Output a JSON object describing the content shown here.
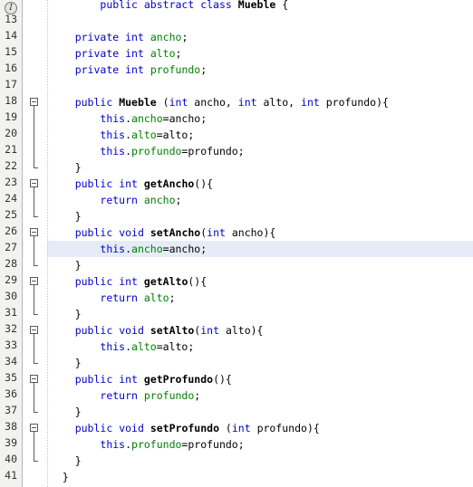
{
  "editor": {
    "language": "java",
    "class_name": "Mueble",
    "caret_line": 27,
    "first_line_number": 13,
    "last_line_number": 41,
    "colors": {
      "background": "#ffffff",
      "gutter_background": "#f2f2f0",
      "gutter_border": "#b8b8b0",
      "line_number": "#333333",
      "caret_line_highlight": "#e6ecf7",
      "keyword": "#0000cd",
      "field": "#008000",
      "declaration": "#000000",
      "plain": "#000000",
      "fold_marker": "#5a5a5a",
      "indent_guide": "#c9c9c9"
    },
    "annotation_icon": {
      "name": "info-annotation-icon",
      "glyph": "I"
    },
    "fold_markers": [
      18,
      23,
      26,
      29,
      32,
      35,
      38
    ],
    "lines": [
      {
        "number": "",
        "partial": true,
        "tokens": [
          {
            "t": "        ",
            "c": "pl"
          },
          {
            "t": "public",
            "c": "kw"
          },
          {
            "t": " ",
            "c": "pl"
          },
          {
            "t": "abstract",
            "c": "kw"
          },
          {
            "t": " ",
            "c": "pl"
          },
          {
            "t": "class",
            "c": "kw"
          },
          {
            "t": " ",
            "c": "pl"
          },
          {
            "t": "Mueble",
            "c": "nm"
          },
          {
            "t": " {",
            "c": "pl"
          }
        ]
      },
      {
        "number": "13",
        "tokens": []
      },
      {
        "number": "14",
        "tokens": [
          {
            "t": "    ",
            "c": "pl"
          },
          {
            "t": "private",
            "c": "kw"
          },
          {
            "t": " ",
            "c": "pl"
          },
          {
            "t": "int",
            "c": "kw"
          },
          {
            "t": " ",
            "c": "pl"
          },
          {
            "t": "ancho",
            "c": "fld"
          },
          {
            "t": ";",
            "c": "pl"
          }
        ]
      },
      {
        "number": "15",
        "tokens": [
          {
            "t": "    ",
            "c": "pl"
          },
          {
            "t": "private",
            "c": "kw"
          },
          {
            "t": " ",
            "c": "pl"
          },
          {
            "t": "int",
            "c": "kw"
          },
          {
            "t": " ",
            "c": "pl"
          },
          {
            "t": "alto",
            "c": "fld"
          },
          {
            "t": ";",
            "c": "pl"
          }
        ]
      },
      {
        "number": "16",
        "tokens": [
          {
            "t": "    ",
            "c": "pl"
          },
          {
            "t": "private",
            "c": "kw"
          },
          {
            "t": " ",
            "c": "pl"
          },
          {
            "t": "int",
            "c": "kw"
          },
          {
            "t": " ",
            "c": "pl"
          },
          {
            "t": "profundo",
            "c": "fld"
          },
          {
            "t": ";",
            "c": "pl"
          }
        ]
      },
      {
        "number": "17",
        "tokens": []
      },
      {
        "number": "18",
        "tokens": [
          {
            "t": "    ",
            "c": "pl"
          },
          {
            "t": "public",
            "c": "kw"
          },
          {
            "t": " ",
            "c": "pl"
          },
          {
            "t": "Mueble",
            "c": "nm"
          },
          {
            "t": " (",
            "c": "pl"
          },
          {
            "t": "int",
            "c": "kw"
          },
          {
            "t": " ancho, ",
            "c": "pl"
          },
          {
            "t": "int",
            "c": "kw"
          },
          {
            "t": " alto, ",
            "c": "pl"
          },
          {
            "t": "int",
            "c": "kw"
          },
          {
            "t": " profundo){",
            "c": "pl"
          }
        ]
      },
      {
        "number": "19",
        "tokens": [
          {
            "t": "        ",
            "c": "pl"
          },
          {
            "t": "this",
            "c": "kw"
          },
          {
            "t": ".",
            "c": "pl"
          },
          {
            "t": "ancho",
            "c": "fld"
          },
          {
            "t": "=ancho;",
            "c": "pl"
          }
        ]
      },
      {
        "number": "20",
        "tokens": [
          {
            "t": "        ",
            "c": "pl"
          },
          {
            "t": "this",
            "c": "kw"
          },
          {
            "t": ".",
            "c": "pl"
          },
          {
            "t": "alto",
            "c": "fld"
          },
          {
            "t": "=alto;",
            "c": "pl"
          }
        ]
      },
      {
        "number": "21",
        "tokens": [
          {
            "t": "        ",
            "c": "pl"
          },
          {
            "t": "this",
            "c": "kw"
          },
          {
            "t": ".",
            "c": "pl"
          },
          {
            "t": "profundo",
            "c": "fld"
          },
          {
            "t": "=profundo;",
            "c": "pl"
          }
        ]
      },
      {
        "number": "22",
        "tokens": [
          {
            "t": "    }",
            "c": "pl"
          }
        ]
      },
      {
        "number": "23",
        "tokens": [
          {
            "t": "    ",
            "c": "pl"
          },
          {
            "t": "public",
            "c": "kw"
          },
          {
            "t": " ",
            "c": "pl"
          },
          {
            "t": "int",
            "c": "kw"
          },
          {
            "t": " ",
            "c": "pl"
          },
          {
            "t": "getAncho",
            "c": "nm"
          },
          {
            "t": "(){",
            "c": "pl"
          }
        ]
      },
      {
        "number": "24",
        "tokens": [
          {
            "t": "        ",
            "c": "pl"
          },
          {
            "t": "return",
            "c": "kw"
          },
          {
            "t": " ",
            "c": "pl"
          },
          {
            "t": "ancho",
            "c": "fld"
          },
          {
            "t": ";",
            "c": "pl"
          }
        ]
      },
      {
        "number": "25",
        "tokens": [
          {
            "t": "    }",
            "c": "pl"
          }
        ]
      },
      {
        "number": "26",
        "tokens": [
          {
            "t": "    ",
            "c": "pl"
          },
          {
            "t": "public",
            "c": "kw"
          },
          {
            "t": " ",
            "c": "pl"
          },
          {
            "t": "void",
            "c": "kw"
          },
          {
            "t": " ",
            "c": "pl"
          },
          {
            "t": "setAncho",
            "c": "nm"
          },
          {
            "t": "(",
            "c": "pl"
          },
          {
            "t": "int",
            "c": "kw"
          },
          {
            "t": " ancho){",
            "c": "pl"
          }
        ]
      },
      {
        "number": "27",
        "highlight": true,
        "tokens": [
          {
            "t": "        ",
            "c": "pl"
          },
          {
            "t": "this",
            "c": "kw"
          },
          {
            "t": ".",
            "c": "pl"
          },
          {
            "t": "ancho",
            "c": "fld"
          },
          {
            "t": "=ancho;",
            "c": "pl"
          }
        ]
      },
      {
        "number": "28",
        "tokens": [
          {
            "t": "    }",
            "c": "pl"
          }
        ]
      },
      {
        "number": "29",
        "tokens": [
          {
            "t": "    ",
            "c": "pl"
          },
          {
            "t": "public",
            "c": "kw"
          },
          {
            "t": " ",
            "c": "pl"
          },
          {
            "t": "int",
            "c": "kw"
          },
          {
            "t": " ",
            "c": "pl"
          },
          {
            "t": "getAlto",
            "c": "nm"
          },
          {
            "t": "(){",
            "c": "pl"
          }
        ]
      },
      {
        "number": "30",
        "tokens": [
          {
            "t": "        ",
            "c": "pl"
          },
          {
            "t": "return",
            "c": "kw"
          },
          {
            "t": " ",
            "c": "pl"
          },
          {
            "t": "alto",
            "c": "fld"
          },
          {
            "t": ";",
            "c": "pl"
          }
        ]
      },
      {
        "number": "31",
        "tokens": [
          {
            "t": "    }",
            "c": "pl"
          }
        ]
      },
      {
        "number": "32",
        "tokens": [
          {
            "t": "    ",
            "c": "pl"
          },
          {
            "t": "public",
            "c": "kw"
          },
          {
            "t": " ",
            "c": "pl"
          },
          {
            "t": "void",
            "c": "kw"
          },
          {
            "t": " ",
            "c": "pl"
          },
          {
            "t": "setAlto",
            "c": "nm"
          },
          {
            "t": "(",
            "c": "pl"
          },
          {
            "t": "int",
            "c": "kw"
          },
          {
            "t": " alto){",
            "c": "pl"
          }
        ]
      },
      {
        "number": "33",
        "tokens": [
          {
            "t": "        ",
            "c": "pl"
          },
          {
            "t": "this",
            "c": "kw"
          },
          {
            "t": ".",
            "c": "pl"
          },
          {
            "t": "alto",
            "c": "fld"
          },
          {
            "t": "=alto;",
            "c": "pl"
          }
        ]
      },
      {
        "number": "34",
        "tokens": [
          {
            "t": "    }",
            "c": "pl"
          }
        ]
      },
      {
        "number": "35",
        "tokens": [
          {
            "t": "    ",
            "c": "pl"
          },
          {
            "t": "public",
            "c": "kw"
          },
          {
            "t": " ",
            "c": "pl"
          },
          {
            "t": "int",
            "c": "kw"
          },
          {
            "t": " ",
            "c": "pl"
          },
          {
            "t": "getProfundo",
            "c": "nm"
          },
          {
            "t": "(){",
            "c": "pl"
          }
        ]
      },
      {
        "number": "36",
        "tokens": [
          {
            "t": "        ",
            "c": "pl"
          },
          {
            "t": "return",
            "c": "kw"
          },
          {
            "t": " ",
            "c": "pl"
          },
          {
            "t": "profundo",
            "c": "fld"
          },
          {
            "t": ";",
            "c": "pl"
          }
        ]
      },
      {
        "number": "37",
        "tokens": [
          {
            "t": "    }",
            "c": "pl"
          }
        ]
      },
      {
        "number": "38",
        "tokens": [
          {
            "t": "    ",
            "c": "pl"
          },
          {
            "t": "public",
            "c": "kw"
          },
          {
            "t": " ",
            "c": "pl"
          },
          {
            "t": "void",
            "c": "kw"
          },
          {
            "t": " ",
            "c": "pl"
          },
          {
            "t": "setProfundo",
            "c": "nm"
          },
          {
            "t": " (",
            "c": "pl"
          },
          {
            "t": "int",
            "c": "kw"
          },
          {
            "t": " profundo){",
            "c": "pl"
          }
        ]
      },
      {
        "number": "39",
        "tokens": [
          {
            "t": "        ",
            "c": "pl"
          },
          {
            "t": "this",
            "c": "kw"
          },
          {
            "t": ".",
            "c": "pl"
          },
          {
            "t": "profundo",
            "c": "fld"
          },
          {
            "t": "=profundo;",
            "c": "pl"
          }
        ]
      },
      {
        "number": "40",
        "tokens": [
          {
            "t": "    }",
            "c": "pl"
          }
        ]
      },
      {
        "number": "41",
        "tokens": [
          {
            "t": "  }",
            "c": "pl"
          }
        ]
      }
    ]
  }
}
